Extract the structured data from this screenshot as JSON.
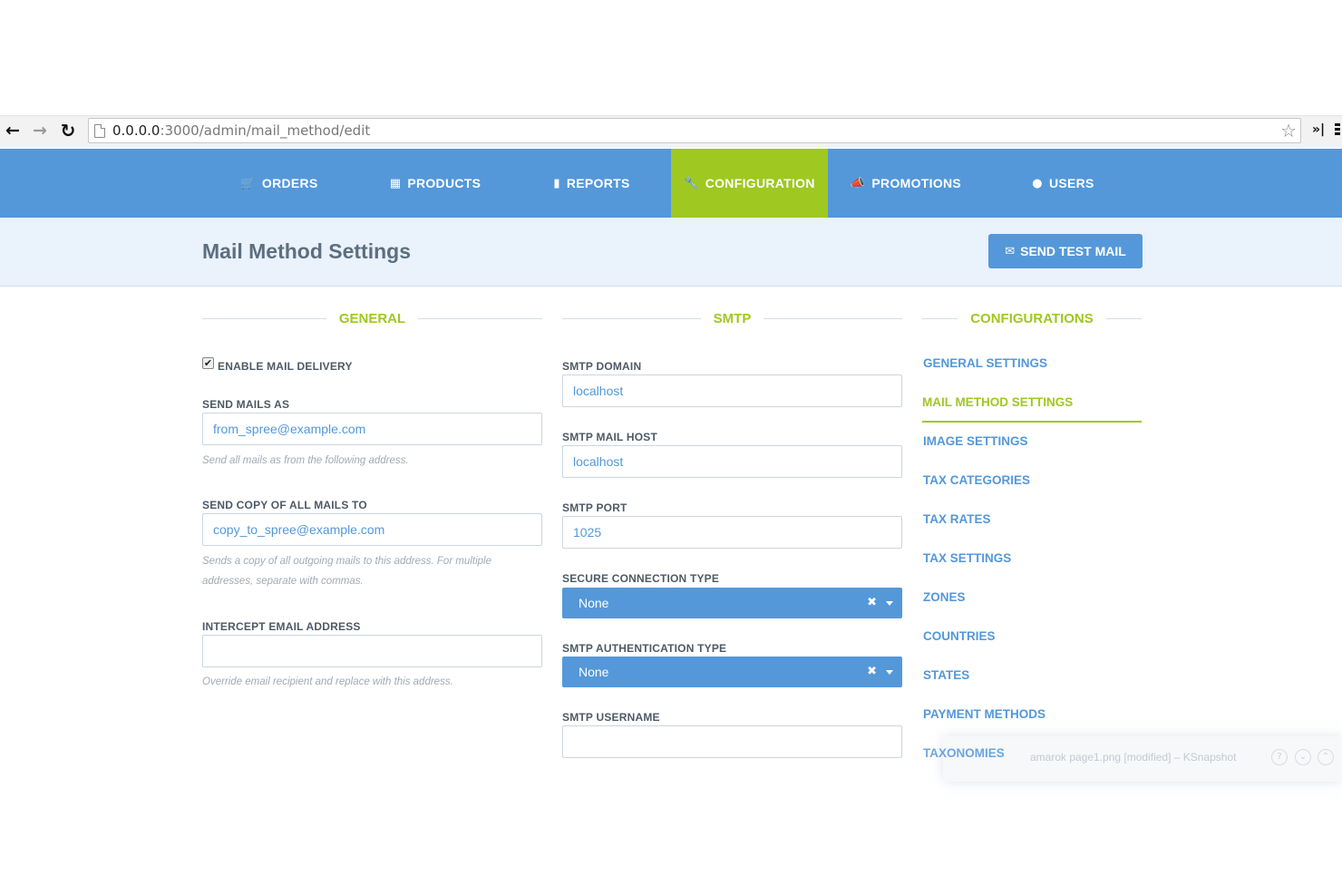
{
  "browser": {
    "url_host": "0.0.0.0",
    "url_path": ":3000/admin/mail_method/edit"
  },
  "nav": {
    "tabs": [
      {
        "label": "ORDERS",
        "icon": "shopping-cart-icon"
      },
      {
        "label": "PRODUCTS",
        "icon": "th-large-icon"
      },
      {
        "label": "REPORTS",
        "icon": "file-icon"
      },
      {
        "label": "CONFIGURATION",
        "icon": "wrench-icon",
        "active": true
      },
      {
        "label": "PROMOTIONS",
        "icon": "bullhorn-icon"
      },
      {
        "label": "USERS",
        "icon": "user-icon"
      }
    ],
    "active_color": "#9fc820",
    "bar_color": "#5498da"
  },
  "header": {
    "title": "Mail Method Settings",
    "send_test_mail_label": "SEND TEST MAIL"
  },
  "general": {
    "heading": "GENERAL",
    "enable_label": "ENABLE MAIL DELIVERY",
    "enable_checked": true,
    "send_as_label": "SEND MAILS AS",
    "send_as_value": "from_spree@example.com",
    "send_as_help": "Send all mails as from the following address.",
    "copy_label": "SEND COPY OF ALL MAILS TO",
    "copy_value": "copy_to_spree@example.com",
    "copy_help_1": "Sends a copy of all outgoing mails to this address. For multiple",
    "copy_help_2": "addresses, separate with commas.",
    "intercept_label": "INTERCEPT EMAIL ADDRESS",
    "intercept_value": "",
    "intercept_help": "Override email recipient and replace with this address."
  },
  "smtp": {
    "heading": "SMTP",
    "domain_label": "SMTP DOMAIN",
    "domain_value": "localhost",
    "host_label": "SMTP MAIL HOST",
    "host_value": "localhost",
    "port_label": "SMTP PORT",
    "port_value": "1025",
    "secure_label": "SECURE CONNECTION TYPE",
    "secure_value": "None",
    "auth_label": "SMTP AUTHENTICATION TYPE",
    "auth_value": "None",
    "username_label": "SMTP USERNAME",
    "username_value": ""
  },
  "configurations": {
    "heading": "CONFIGURATIONS",
    "links": [
      "GENERAL SETTINGS",
      "MAIL METHOD SETTINGS",
      "IMAGE SETTINGS",
      "TAX CATEGORIES",
      "TAX RATES",
      "TAX SETTINGS",
      "ZONES",
      "COUNTRIES",
      "STATES",
      "PAYMENT METHODS",
      "TAXONOMIES"
    ]
  },
  "notification": {
    "text": "amarok page1.png [modified] – KSnapshot"
  }
}
